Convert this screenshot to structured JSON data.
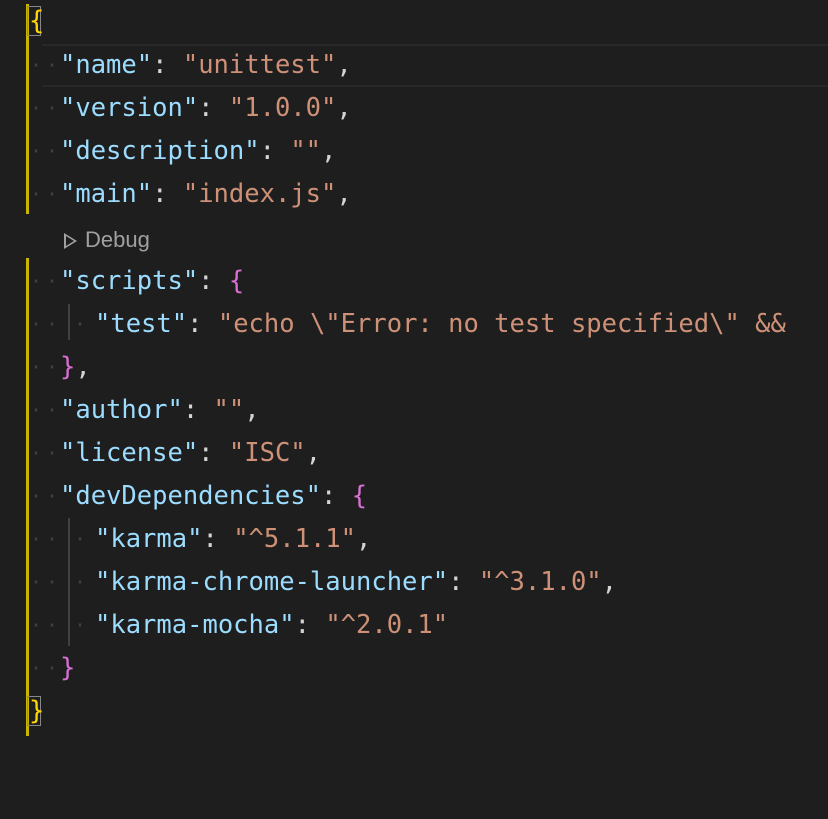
{
  "codelens": {
    "label": "Debug"
  },
  "lines": {
    "open_brace": "{",
    "name_key": "\"name\"",
    "name_val": "\"unittest\"",
    "version_key": "\"version\"",
    "version_val": "\"1.0.0\"",
    "description_key": "\"description\"",
    "description_val": "\"\"",
    "main_key": "\"main\"",
    "main_val": "\"index.js\"",
    "scripts_key": "\"scripts\"",
    "scripts_open": "{",
    "test_key": "\"test\"",
    "test_val": "\"echo \\\"Error: no test specified\\\" &&",
    "scripts_close": "}",
    "author_key": "\"author\"",
    "author_val": "\"\"",
    "license_key": "\"license\"",
    "license_val": "\"ISC\"",
    "devdeps_key": "\"devDependencies\"",
    "devdeps_open": "{",
    "karma_key": "\"karma\"",
    "karma_val": "\"^5.1.1\"",
    "kcl_key": "\"karma-chrome-launcher\"",
    "kcl_val": "\"^3.1.0\"",
    "km_key": "\"karma-mocha\"",
    "km_val": "\"^2.0.1\"",
    "devdeps_close": "}",
    "close_brace": "}"
  },
  "punct": {
    "colon": ": ",
    "comma": ",",
    "close_comma": "},"
  },
  "colors": {
    "background": "#1e1e1e",
    "key": "#9cdcfe",
    "string": "#ce9178",
    "bracket_level1": "#ffd700",
    "bracket_level2": "#da70d6",
    "fold_bar": "#c8b600"
  }
}
